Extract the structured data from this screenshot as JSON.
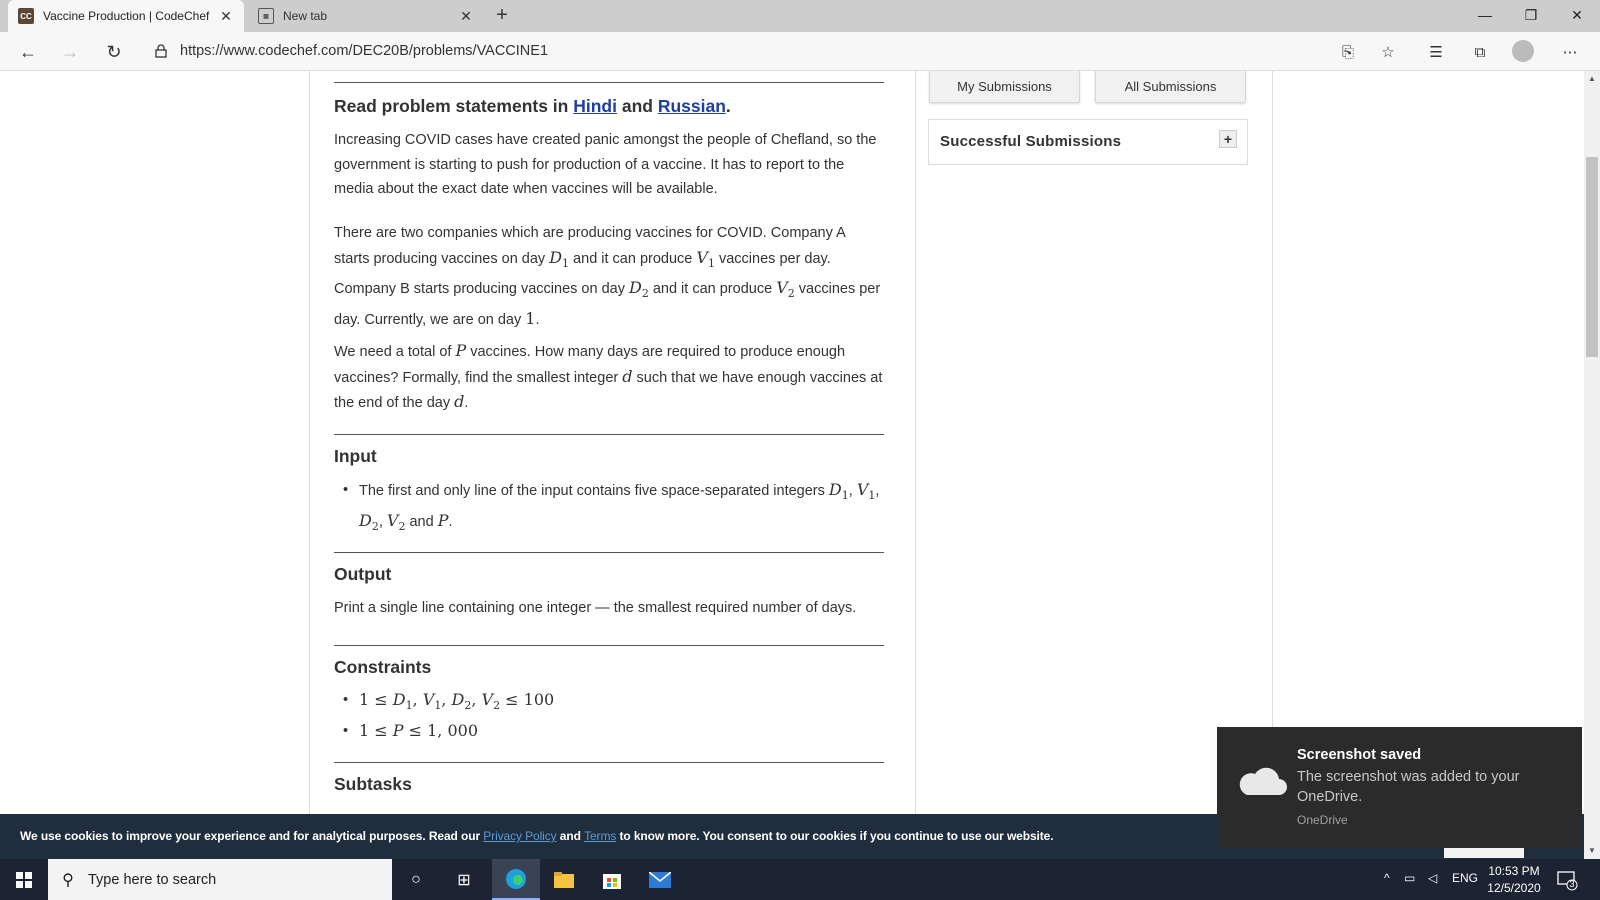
{
  "browser": {
    "tabs": [
      {
        "favicon": "CC",
        "title": "Vaccine Production | CodeChef",
        "active": true
      },
      {
        "favicon": "new-tab",
        "title": "New tab",
        "active": false
      }
    ],
    "url": "https://www.codechef.com/DEC20B/problems/VACCINE1",
    "win_controls": {
      "minimize": "—",
      "restore": "❐",
      "close": "✕"
    }
  },
  "page": {
    "buttons": {
      "my_submissions": "My Submissions",
      "all_submissions": "All Submissions"
    },
    "successful_submissions": "Successful Submissions",
    "read_statements": {
      "prefix": "Read problem statements in ",
      "hindi": "Hindi",
      "and": " and ",
      "russian": "Russian",
      "suffix": "."
    },
    "intro": "Increasing COVID cases have created panic amongst the people of Chefland, so the government is starting to push for production of a vaccine. It has to report to the media about the exact date when vaccines will be available.",
    "companies": {
      "t1": "There are two companies which are producing vaccines for COVID. Company A starts producing vaccines on day ",
      "t2": " and it can produce ",
      "t3": " vaccines per day. Company B starts producing vaccines on day ",
      "t4": " and it can produce ",
      "t5": " vaccines per day. Currently, we are on day ",
      "t6": "."
    },
    "need": {
      "t1": "We need a total of ",
      "t2": " vaccines. How many days are required to produce enough vaccines? Formally, find the smallest integer ",
      "t3": " such that we have enough vaccines at the end of the day ",
      "t4": "."
    },
    "input_heading": "Input",
    "input_item": {
      "t1": "The first and only line of the input contains five space-separated integers ",
      "and": " and "
    },
    "output_heading": "Output",
    "output_text": "Print a single line containing one integer — the smallest required number of days.",
    "constraints_heading": "Constraints",
    "subtasks_heading": "Subtasks"
  },
  "cookie": {
    "t1": "We use cookies to improve your experience and for analytical purposes. Read our ",
    "privacy": "Privacy Policy",
    "and": " and ",
    "terms": "Terms",
    "t2": " to know more. You consent to our cookies if you continue to use our website."
  },
  "toast": {
    "title": "Screenshot saved",
    "body": "The screenshot was added to your OneDrive.",
    "source": "OneDrive"
  },
  "taskbar": {
    "search_placeholder": "Type here to search",
    "lang": "ENG",
    "time": "10:53 PM",
    "date": "12/5/2020",
    "notifications": "3"
  }
}
